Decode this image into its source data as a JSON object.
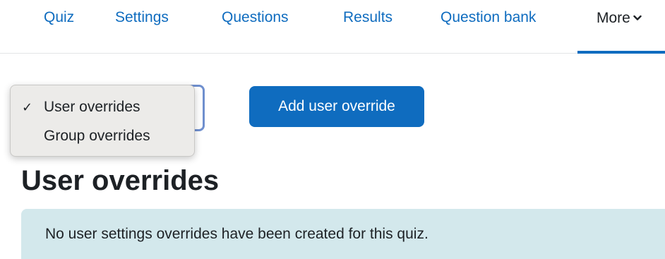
{
  "nav": {
    "items": [
      {
        "label": "Quiz"
      },
      {
        "label": "Settings"
      },
      {
        "label": "Questions"
      },
      {
        "label": "Results"
      },
      {
        "label": "Question bank"
      }
    ],
    "more_label": "More",
    "more_icon": "chevron-down-icon"
  },
  "overrides_select": {
    "options": [
      {
        "label": "User overrides",
        "selected": true
      },
      {
        "label": "Group overrides",
        "selected": false
      }
    ],
    "check_glyph": "✓"
  },
  "toolbar": {
    "add_label": "Add user override"
  },
  "main": {
    "heading": "User overrides",
    "alert_text": "No user settings overrides have been created for this quiz."
  },
  "colors": {
    "primary": "#0f6cbf",
    "text": "#1d2125",
    "alert_bg": "#d3e8ec",
    "dropdown_bg": "#ecebe9"
  }
}
